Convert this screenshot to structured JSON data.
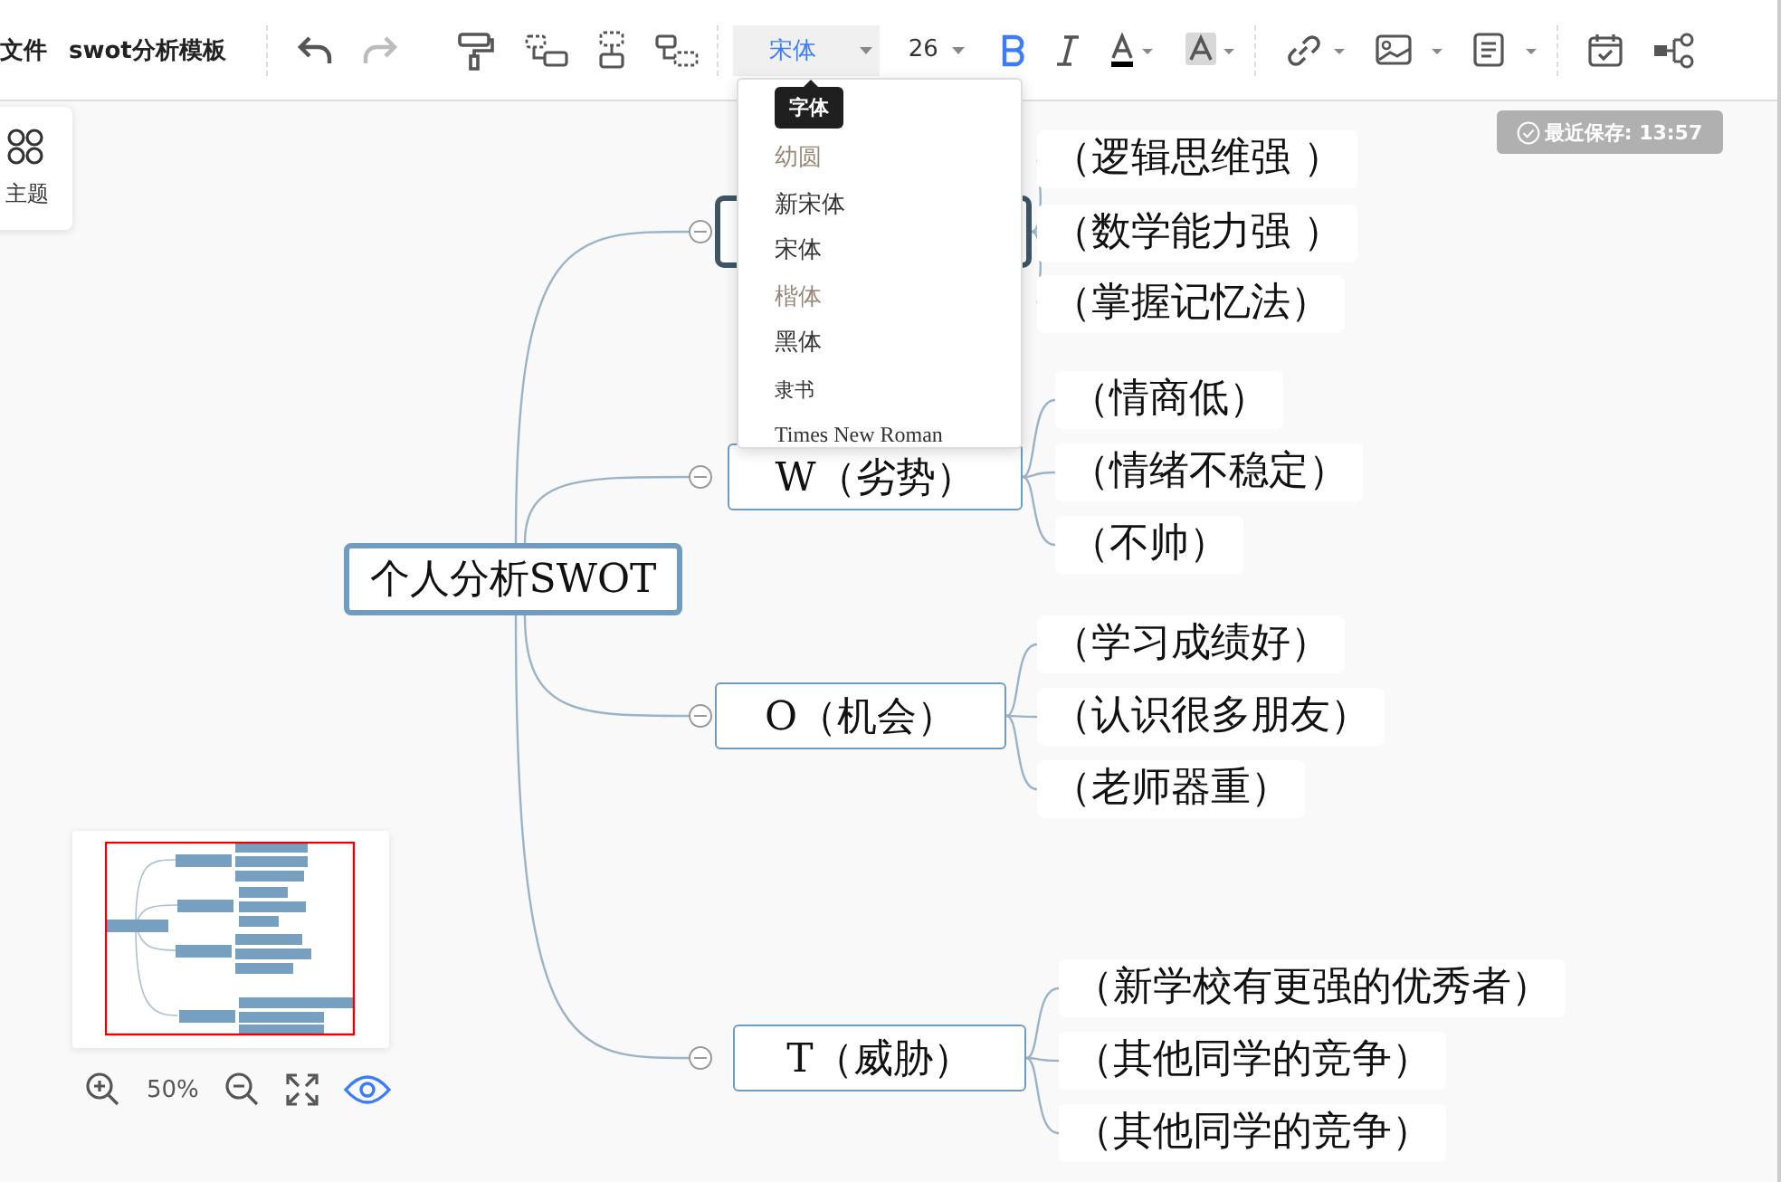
{
  "toolbar": {
    "menu": "文件",
    "title": "swot分析模板",
    "font_family": "宋体",
    "font_size": "26",
    "bold": true,
    "italic": false
  },
  "font_dropdown": {
    "tooltip": "字体",
    "options": [
      {
        "label": "幼圆",
        "dimmed": true
      },
      {
        "label": "新宋体",
        "dimmed": false
      },
      {
        "label": "宋体",
        "dimmed": false
      },
      {
        "label": "楷体",
        "dimmed": true
      },
      {
        "label": "黑体",
        "dimmed": false
      },
      {
        "label": "隶书",
        "dimmed": false
      },
      {
        "label": "Times New Roman",
        "dimmed": false
      }
    ]
  },
  "save_status": "最近保存: 13:57",
  "theme_button": "主题",
  "mindmap": {
    "root": "个人分析SWOT",
    "branches": [
      {
        "selected": true,
        "children": [
          "（逻辑思维强 ）",
          "（数学能力强 ）",
          "（掌握记忆法）"
        ]
      },
      {
        "label": "W（劣势）",
        "selected": false,
        "children": [
          "（情商低）",
          "（情绪不稳定）",
          "（不帅）"
        ]
      },
      {
        "label": "O（机会）",
        "selected": false,
        "children": [
          "（学习成绩好）",
          "（认识很多朋友）",
          "（老师器重）"
        ]
      },
      {
        "label": "T（威胁）",
        "selected": false,
        "children": [
          "（新学校有更强的优秀者）",
          "（其他同学的竞争）",
          "（其他同学的竞争）"
        ]
      }
    ]
  },
  "zoom": {
    "percent": "50%"
  }
}
